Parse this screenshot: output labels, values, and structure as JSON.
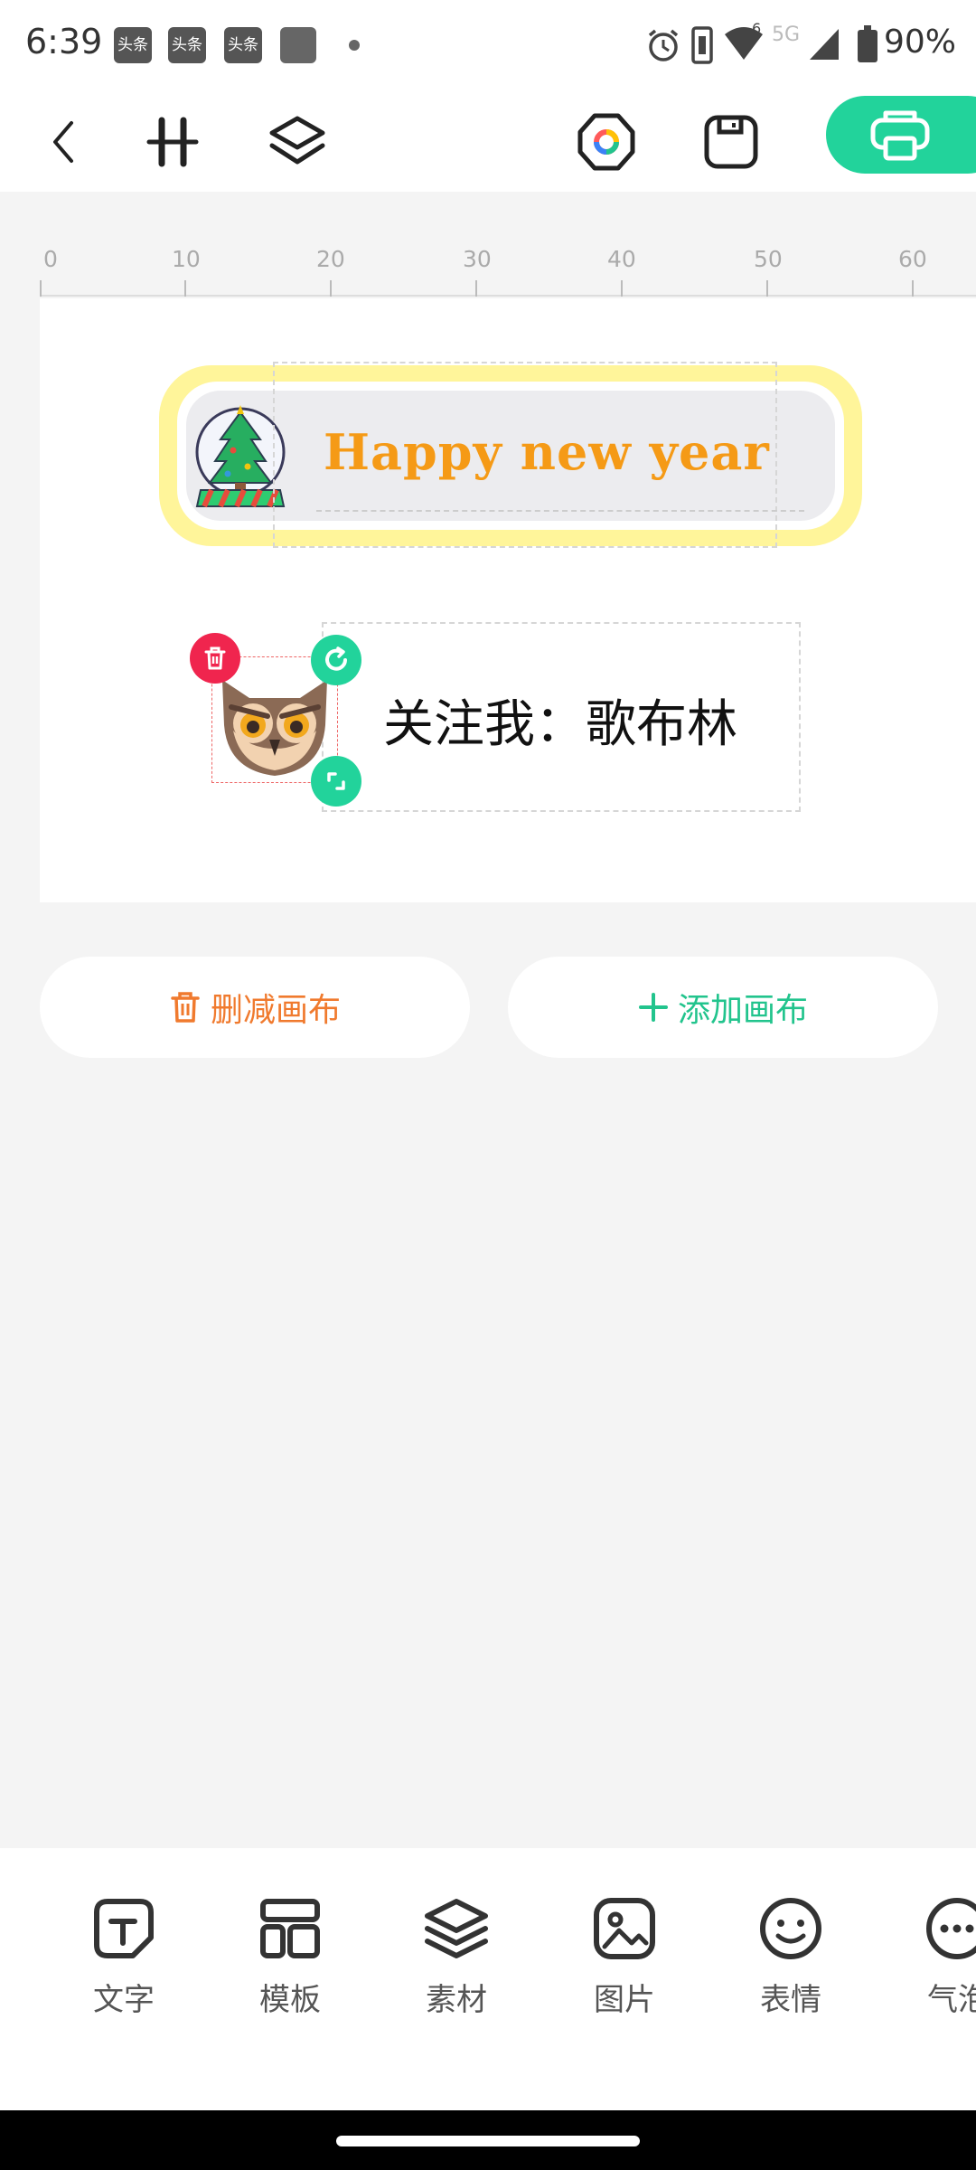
{
  "status_bar": {
    "time": "6:39",
    "notifications": [
      "头条",
      "头条",
      "头条"
    ],
    "battery": "90%",
    "network_label": "5G",
    "wifi_badge": "6",
    "icons": [
      "alarm-icon",
      "vibrate-icon",
      "wifi-icon",
      "signal-icon",
      "battery-icon"
    ]
  },
  "toolbar": {
    "icons": [
      "back-icon",
      "align-icon",
      "layers-icon",
      "color-wheel-icon",
      "save-icon",
      "print-icon"
    ],
    "accent": "#22d39b"
  },
  "ruler": {
    "labels": [
      "0",
      "10",
      "20",
      "30",
      "40",
      "50",
      "60"
    ]
  },
  "canvas": {
    "label_text": "Happy new year",
    "label_text_color": "#f59a16",
    "label_frame_color": "#fff59a",
    "follow_text": "关注我：歌布林"
  },
  "actions": {
    "delete_canvas": "删减画布",
    "add_canvas": "添加画布",
    "delete_color": "#f07a2e",
    "add_color": "#22c48d"
  },
  "bottom_nav": {
    "items": [
      {
        "label": "文字",
        "icon": "text-icon"
      },
      {
        "label": "模板",
        "icon": "template-icon"
      },
      {
        "label": "素材",
        "icon": "material-icon"
      },
      {
        "label": "图片",
        "icon": "image-icon"
      },
      {
        "label": "表情",
        "icon": "emoji-icon"
      },
      {
        "label": "气泡",
        "icon": "bubble-icon"
      }
    ]
  }
}
